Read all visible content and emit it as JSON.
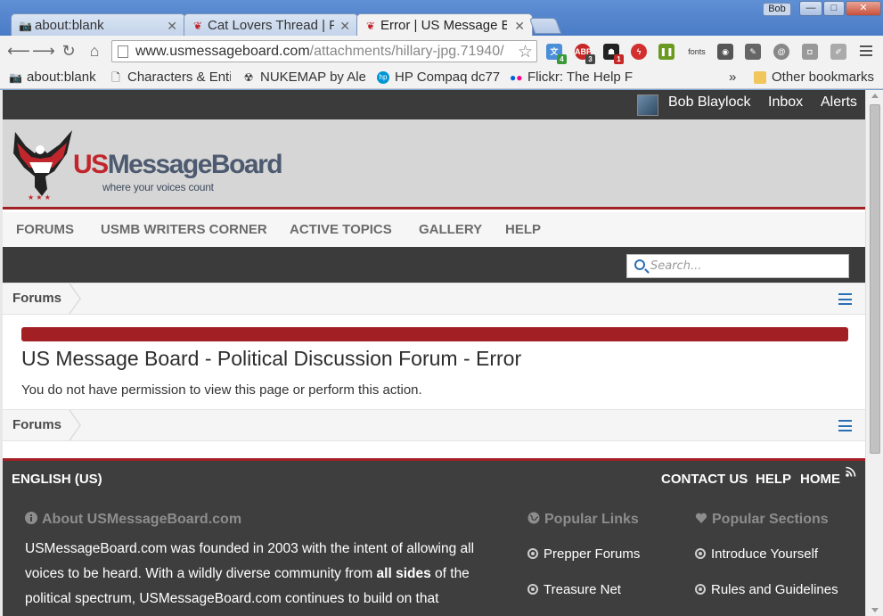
{
  "browser": {
    "tabs": [
      {
        "title": "about:blank",
        "favicon": "camera-icon"
      },
      {
        "title": "Cat Lovers Thread | P",
        "favicon": "usmb-eagle-icon"
      },
      {
        "title": "Error | US Message B",
        "favicon": "usmb-eagle-icon"
      }
    ],
    "profile_name": "Bob",
    "window_controls": {
      "minimize": "—",
      "maximize": "□",
      "close": "✕"
    },
    "address": {
      "host": "www.usmessageboard.com",
      "path": "/attachments/hillary-jpg.71940/"
    },
    "extensions": [
      {
        "name": "translate-extension-icon",
        "badge": "4"
      },
      {
        "name": "adblock-extension-icon",
        "label": "ABP",
        "badge": "3"
      },
      {
        "name": "ghost-extension-icon",
        "badge": "1"
      },
      {
        "name": "flash-extension-icon"
      },
      {
        "name": "pause-extension-icon"
      },
      {
        "name": "fonts-extension-icon",
        "label": "fonts"
      },
      {
        "name": "screenshot-extension-icon"
      },
      {
        "name": "tools-extension-icon"
      },
      {
        "name": "spiral-extension-icon"
      },
      {
        "name": "camera-extension-icon"
      },
      {
        "name": "pen-extension-icon"
      }
    ],
    "bookmarks": [
      {
        "label": "about:blank"
      },
      {
        "label": "Characters & Enti"
      },
      {
        "label": "NUKEMAP by Ale"
      },
      {
        "label": "HP Compaq dc77"
      },
      {
        "label": "Flickr: The Help F"
      }
    ],
    "bookmarks_overflow": "»",
    "other_bookmarks": "Other bookmarks"
  },
  "site": {
    "user_bar": {
      "user_name": "Bob Blaylock",
      "inbox": "Inbox",
      "alerts": "Alerts"
    },
    "logo": {
      "part1": "US",
      "part2": "MessageBoard",
      "tagline": "where your voices count"
    },
    "nav": [
      "FORUMS",
      "USMB WRITERS CORNER",
      "ACTIVE TOPICS",
      "GALLERY",
      "HELP"
    ],
    "search": {
      "placeholder": "Search..."
    },
    "breadcrumb": "Forums",
    "error": {
      "title": "US Message Board - Political Discussion Forum - Error",
      "message": "You do not have permission to view this page or perform this action."
    },
    "footer": {
      "language": "ENGLISH (US)",
      "links": {
        "contact": "CONTACT US",
        "help": "HELP",
        "home": "HOME"
      },
      "about_heading": "About USMessageBoard.com",
      "about_text_1": "USMessageBoard.com was founded in 2003 with the intent of allowing all voices to be heard. With a wildly diverse community from ",
      "about_text_bold": "all sides",
      "about_text_2": " of the political spectrum, USMessageBoard.com continues to build on that",
      "popular_links_heading": "Popular Links",
      "popular_links": [
        "Prepper Forums",
        "Treasure Net"
      ],
      "popular_sections_heading": "Popular Sections",
      "popular_sections": [
        "Introduce Yourself",
        "Rules and Guidelines"
      ]
    }
  },
  "colors": {
    "brand_red": "#a21f24",
    "link_blue": "#2a6fb5",
    "dark_bar": "#3b3b3b"
  }
}
